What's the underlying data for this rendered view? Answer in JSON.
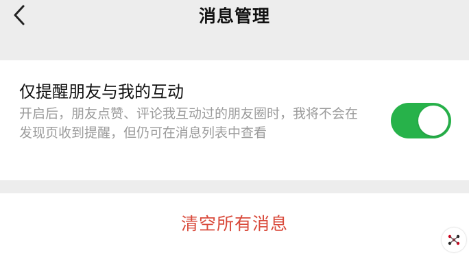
{
  "header": {
    "title": "消息管理",
    "back_icon": "chevron-left-icon"
  },
  "setting": {
    "title": "仅提醒朋友与我的互动",
    "description": "开启后，朋友点赞、评论我互动过的朋友圈时，我将不会在发现页收到提醒，但仍可在消息列表中查看",
    "toggle_on": true
  },
  "actions": {
    "clear_all_label": "清空所有消息"
  },
  "colors": {
    "background": "#ededed",
    "toggle_on": "#27b24a",
    "destructive": "#d94a3b",
    "secondary_text": "#9b9b9b"
  }
}
